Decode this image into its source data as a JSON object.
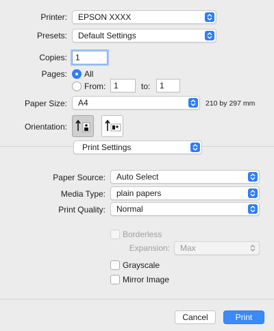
{
  "printer": {
    "label": "Printer:",
    "value": "EPSON XXXX"
  },
  "presets": {
    "label": "Presets:",
    "value": "Default Settings"
  },
  "copies": {
    "label": "Copies:",
    "value": "1"
  },
  "pages": {
    "label": "Pages:",
    "all_label": "All",
    "from_label": "From:",
    "from_value": "1",
    "to_label": "to:",
    "to_value": "1"
  },
  "paper_size": {
    "label": "Paper Size:",
    "value": "A4",
    "dimensions": "210 by 297 mm"
  },
  "orientation": {
    "label": "Orientation:"
  },
  "section_menu": {
    "value": "Print Settings"
  },
  "paper_source": {
    "label": "Paper Source:",
    "value": "Auto Select"
  },
  "media_type": {
    "label": "Media Type:",
    "value": "plain papers"
  },
  "print_quality": {
    "label": "Print Quality:",
    "value": "Normal"
  },
  "borderless": {
    "label": "Borderless"
  },
  "expansion": {
    "label": "Expansion:",
    "value": "Max"
  },
  "grayscale": {
    "label": "Grayscale"
  },
  "mirror_image": {
    "label": "Mirror Image"
  },
  "buttons": {
    "cancel": "Cancel",
    "print": "Print"
  }
}
